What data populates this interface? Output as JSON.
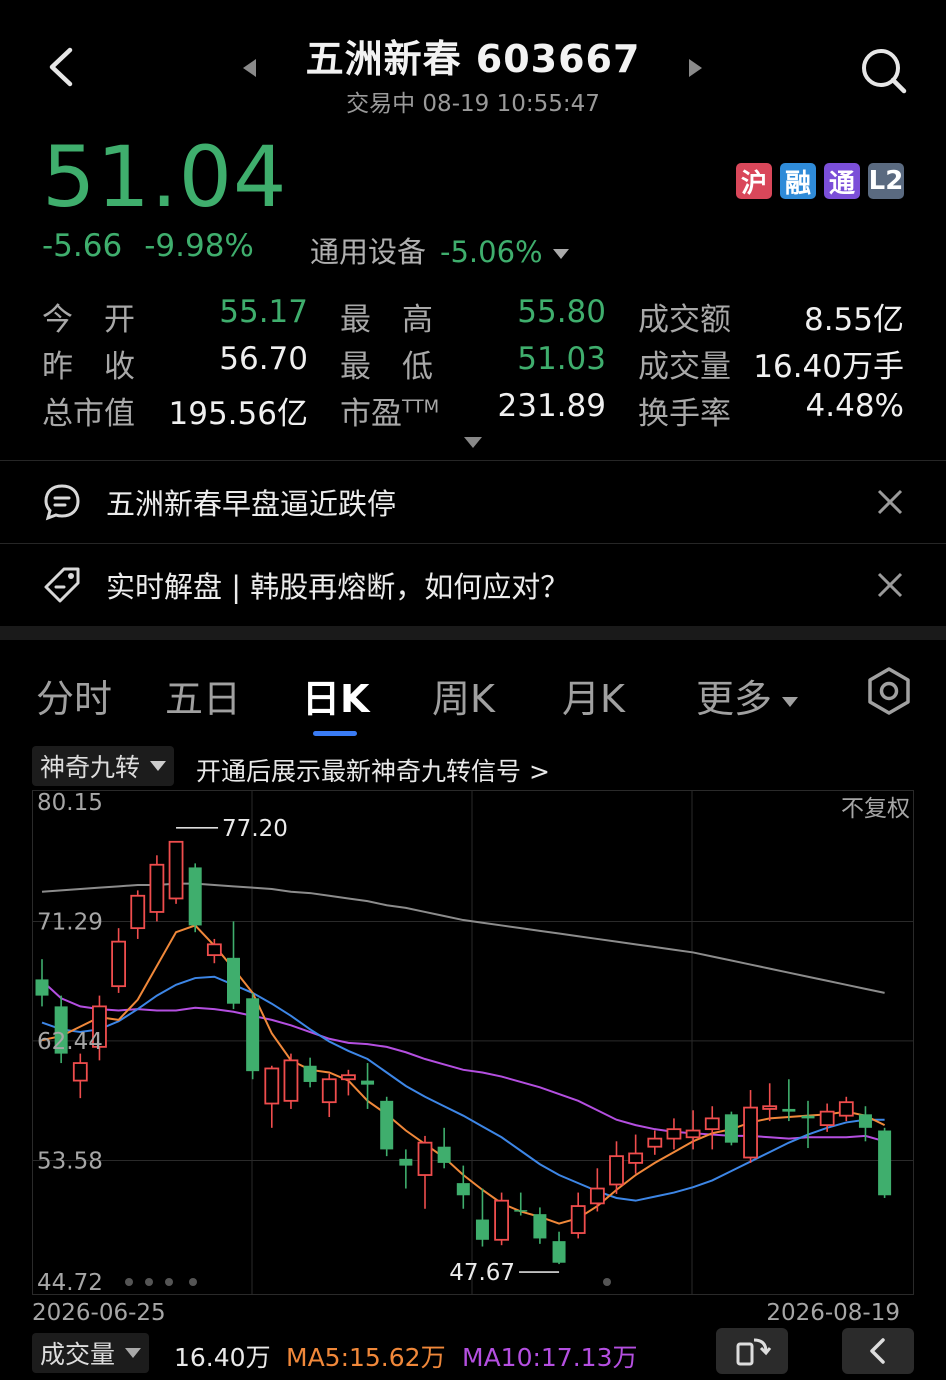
{
  "header": {
    "title": "五洲新春 603667",
    "status": "交易中",
    "datetime": "08-19 10:55:47"
  },
  "quote": {
    "price": "51.04",
    "change": "-5.66",
    "change_pct": "-9.98%",
    "sector": "通用设备",
    "sector_pct": "-5.06%",
    "badges": [
      {
        "label": "沪",
        "color": "#d9475a"
      },
      {
        "label": "融",
        "color": "#2f8bd8"
      },
      {
        "label": "通",
        "color": "#7b4fd8"
      },
      {
        "label": "L2",
        "color": "#5a6a80"
      }
    ]
  },
  "stats": {
    "open_label": "今　开",
    "open": "55.17",
    "high_label": "最　高",
    "high": "55.80",
    "amount_label": "成交额",
    "amount": "8.55亿",
    "prev_label": "昨　收",
    "prev": "56.70",
    "low_label": "最　低",
    "low": "51.03",
    "volume_label": "成交量",
    "volume": "16.40万手",
    "mcap_label": "总市值",
    "mcap": "195.56亿",
    "pe_label": "市盈",
    "pe_sup": "TTM",
    "pe": "231.89",
    "turnover_label": "换手率",
    "turnover": "4.48%"
  },
  "news": [
    {
      "text": "五洲新春早盘逼近跌停",
      "icon": "chat-bubble-icon"
    },
    {
      "text": "实时解盘 | 韩股再熔断，如何应对？",
      "icon": "tag-icon"
    }
  ],
  "tabs": [
    {
      "label": "分时"
    },
    {
      "label": "五日"
    },
    {
      "label": "日K"
    },
    {
      "label": "周K"
    },
    {
      "label": "月K"
    },
    {
      "label": "更多"
    }
  ],
  "magic": {
    "label": "神奇九转",
    "info": "开通后展示最新神奇九转信号 >"
  },
  "chart_data": {
    "type": "candlestick",
    "y_ticks": [
      "80.15",
      "71.29",
      "62.44",
      "53.58",
      "44.72"
    ],
    "ylim": [
      44.72,
      80.15
    ],
    "adjust_label": "不复权",
    "start_date": "2026-06-25",
    "end_date": "2026-08-19",
    "max_label": "77.20",
    "min_label": "47.67",
    "colors": {
      "up": "#ef4d4d",
      "down": "#3fae6d",
      "ma5": "#f0883a",
      "ma10": "#3d86e6",
      "ma20": "#b44fe0",
      "ma60": "#8c8c8c"
    },
    "candles": [
      [
        67.0,
        65.8,
        68.5,
        65.0
      ],
      [
        65.0,
        61.5,
        65.8,
        60.8
      ],
      [
        59.5,
        60.8,
        61.5,
        58.2
      ],
      [
        62.0,
        65.0,
        65.8,
        61.0
      ],
      [
        66.5,
        69.8,
        70.8,
        66.0
      ],
      [
        70.8,
        73.2,
        73.6,
        70.0
      ],
      [
        72.0,
        75.5,
        76.2,
        71.3
      ],
      [
        73.0,
        77.2,
        77.2,
        72.6
      ],
      [
        75.3,
        71.0,
        75.6,
        70.5
      ],
      [
        68.8,
        69.6,
        70.0,
        68.2
      ],
      [
        68.6,
        65.2,
        71.3,
        64.8
      ],
      [
        65.6,
        60.2,
        66.0,
        59.6
      ],
      [
        57.8,
        60.4,
        60.6,
        56.0
      ],
      [
        58.0,
        61.0,
        61.5,
        57.4
      ],
      [
        60.6,
        59.4,
        61.2,
        59.0
      ],
      [
        57.9,
        59.6,
        60.0,
        56.8
      ],
      [
        59.6,
        59.9,
        60.3,
        58.4
      ],
      [
        59.5,
        59.2,
        60.8,
        57.4
      ],
      [
        58.0,
        54.4,
        58.3,
        53.9
      ],
      [
        53.7,
        53.2,
        54.4,
        51.5
      ],
      [
        52.5,
        54.9,
        55.4,
        50.0
      ],
      [
        54.6,
        53.4,
        56.0,
        53.0
      ],
      [
        51.9,
        51.0,
        53.2,
        50.0
      ],
      [
        49.2,
        47.7,
        51.5,
        47.2
      ],
      [
        47.7,
        50.6,
        51.2,
        47.3
      ],
      [
        49.9,
        49.8,
        51.2,
        49.5
      ],
      [
        49.6,
        47.8,
        50.1,
        47.4
      ],
      [
        47.6,
        46.0,
        48.3,
        45.9
      ],
      [
        48.2,
        50.2,
        51.2,
        47.8
      ],
      [
        50.4,
        51.5,
        53.0,
        49.8
      ],
      [
        51.8,
        53.9,
        55.0,
        51.1
      ],
      [
        53.4,
        54.1,
        55.5,
        52.6
      ],
      [
        54.6,
        55.2,
        55.8,
        54.0
      ],
      [
        55.2,
        55.9,
        56.7,
        54.4
      ],
      [
        55.3,
        55.8,
        57.3,
        54.4
      ],
      [
        55.9,
        56.7,
        57.6,
        54.4
      ],
      [
        57.0,
        54.9,
        57.2,
        54.7
      ],
      [
        53.8,
        57.5,
        58.8,
        53.4
      ],
      [
        57.4,
        57.6,
        59.3,
        56.5
      ],
      [
        57.4,
        57.2,
        59.6,
        56.5
      ],
      [
        56.9,
        56.7,
        58.0,
        54.5
      ],
      [
        56.2,
        57.2,
        57.8,
        55.7
      ],
      [
        56.9,
        57.9,
        58.3,
        56.5
      ],
      [
        57.0,
        56.0,
        57.6,
        55.0
      ],
      [
        55.8,
        51.0,
        56.0,
        50.8
      ]
    ],
    "ma5": [
      62.5,
      62.8,
      63.5,
      64.2,
      64.0,
      65.5,
      68.0,
      70.5,
      71.0,
      69.5,
      67.8,
      66.0,
      63.0,
      61.0,
      60.3,
      60.1,
      59.5,
      58.0,
      57.0,
      55.8,
      54.8,
      53.8,
      52.5,
      51.4,
      50.4,
      49.8,
      49.4,
      48.9,
      49.3,
      50.2,
      51.4,
      52.5,
      53.4,
      54.2,
      55.0,
      55.6,
      55.9,
      56.4,
      56.7,
      56.8,
      56.9,
      57.0,
      57.2,
      56.9,
      56.2
    ],
    "ma10": [
      63.8,
      63.3,
      63.1,
      63.3,
      63.9,
      64.8,
      65.8,
      66.6,
      67.1,
      67.2,
      66.6,
      66.0,
      65.2,
      64.3,
      63.3,
      62.4,
      61.7,
      61.1,
      60.1,
      59.1,
      58.3,
      57.6,
      56.9,
      56.1,
      55.3,
      54.3,
      53.3,
      52.5,
      51.9,
      51.3,
      50.8,
      50.6,
      50.9,
      51.2,
      51.6,
      52.1,
      52.8,
      53.5,
      54.2,
      54.9,
      55.5,
      56.0,
      56.4,
      56.6,
      56.6
    ],
    "ma20": [
      66.9,
      65.6,
      65.0,
      64.8,
      64.7,
      64.8,
      64.7,
      64.7,
      64.9,
      64.8,
      64.6,
      64.3,
      64.0,
      63.6,
      63.1,
      62.6,
      62.3,
      62.2,
      62.0,
      61.6,
      61.1,
      60.7,
      60.3,
      60.1,
      59.8,
      59.4,
      59.0,
      58.5,
      58.0,
      57.3,
      56.6,
      56.2,
      55.9,
      55.7,
      55.6,
      55.5,
      55.4,
      55.4,
      55.3,
      55.2,
      55.3,
      55.3,
      55.3,
      55.4,
      55.0
    ],
    "ma60": [
      73.5,
      73.6,
      73.7,
      73.8,
      73.9,
      74.0,
      74.0,
      74.1,
      74.1,
      74.0,
      73.9,
      73.8,
      73.7,
      73.5,
      73.4,
      73.2,
      73.0,
      72.8,
      72.5,
      72.3,
      72.0,
      71.7,
      71.4,
      71.2,
      71.0,
      70.8,
      70.6,
      70.4,
      70.2,
      70.0,
      69.8,
      69.6,
      69.4,
      69.2,
      69.0,
      68.7,
      68.4,
      68.1,
      67.8,
      67.5,
      67.2,
      66.9,
      66.6,
      66.3,
      66.0
    ]
  },
  "volume": {
    "label": "成交量",
    "value": "16.40万",
    "ma5": "MA5:15.62万",
    "ma10": "MA10:17.13万"
  }
}
